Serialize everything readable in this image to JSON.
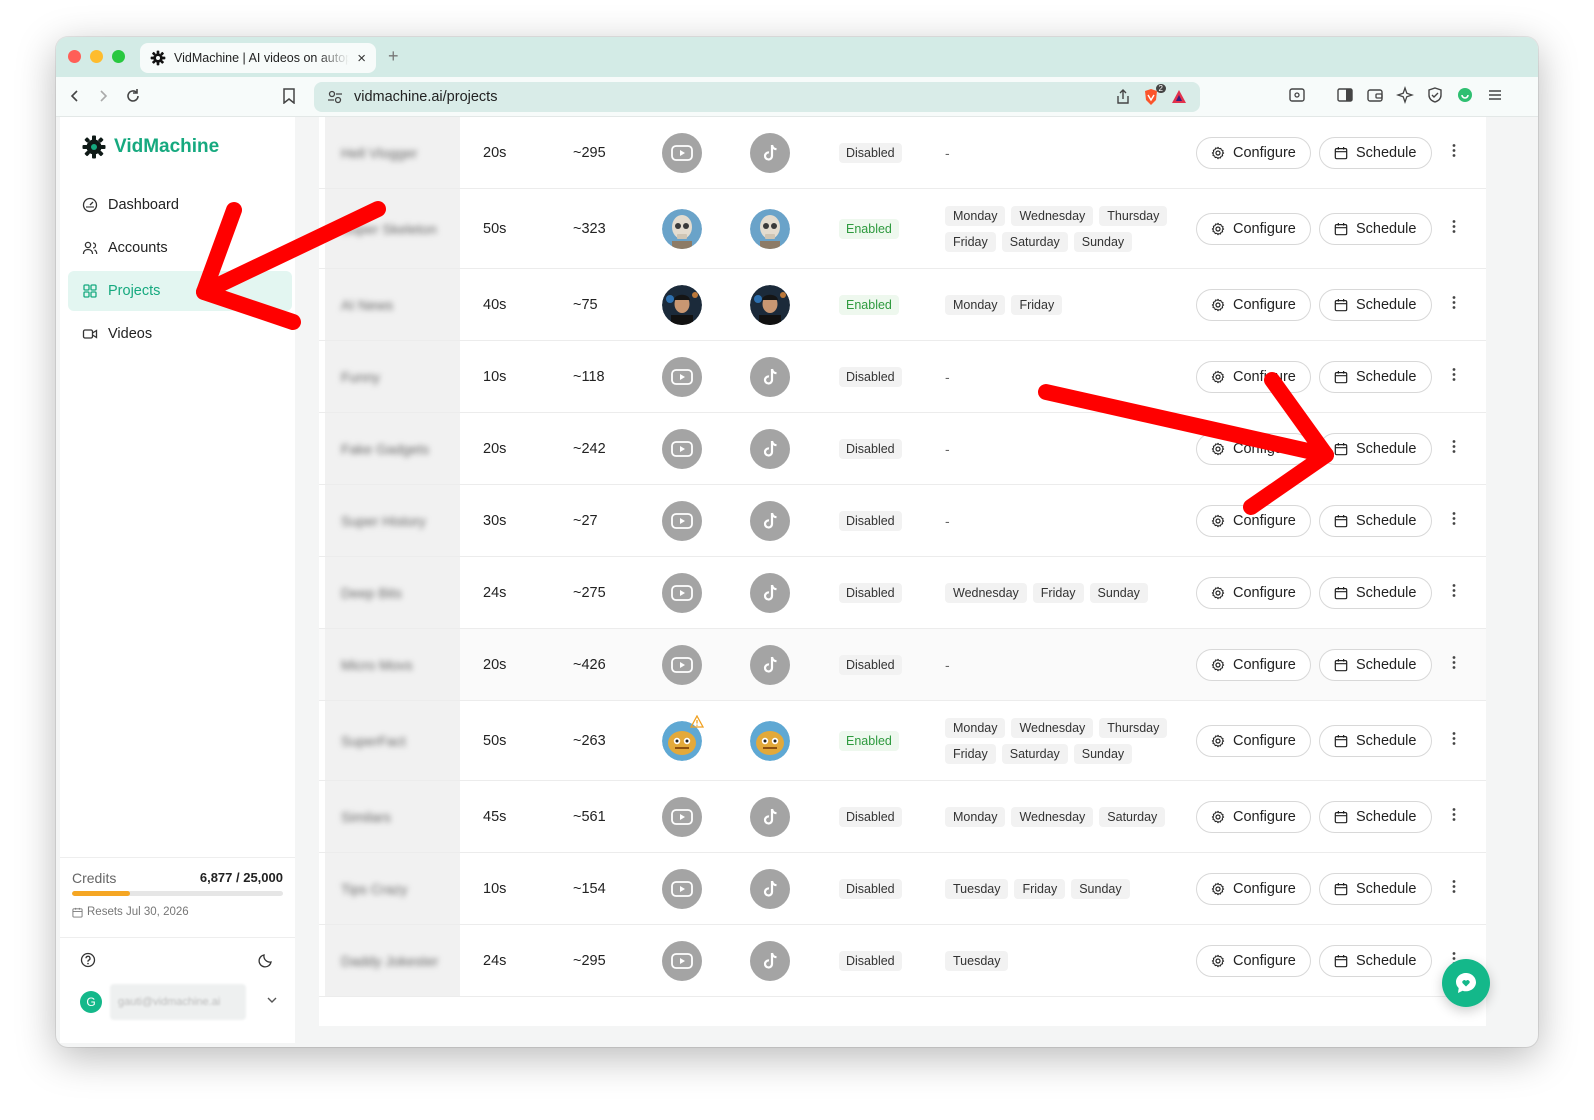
{
  "browser": {
    "tab_title": "VidMachine | AI videos on autopilot",
    "url": "vidmachine.ai/projects",
    "brave_badge": "2",
    "new_tab": "+",
    "close_tab": "×"
  },
  "sidebar": {
    "brand": "VidMachine",
    "items": [
      {
        "label": "Dashboard",
        "icon": "gauge-icon"
      },
      {
        "label": "Accounts",
        "icon": "users-icon"
      },
      {
        "label": "Projects",
        "icon": "grid-icon",
        "active": true
      },
      {
        "label": "Videos",
        "icon": "video-icon"
      }
    ],
    "credits_label": "Credits",
    "credits_value": "6,877 / 25,000",
    "credits_used_fraction": 0.275,
    "resets": "Resets Jul 30, 2026",
    "user_initial": "G",
    "user_email": "gauti@vidmachine.ai"
  },
  "colors": {
    "brand": "#16a97f",
    "enabled_text": "#2e9a3e",
    "credits_bar": "#f5a623",
    "arrow": "#ff0000"
  },
  "table": {
    "configure_label": "Configure",
    "schedule_label": "Schedule",
    "rows": [
      {
        "name": "Hell Vlogger",
        "duration": "20s",
        "count": "~295",
        "yt": "youtube-icon",
        "tt": "tiktok-icon",
        "status": "Disabled",
        "days": [
          "-"
        ]
      },
      {
        "name": "Super Skeleton",
        "duration": "50s",
        "count": "~323",
        "yt": "skeleton-avatar",
        "tt": "skeleton-avatar",
        "status": "Enabled",
        "days": [
          "Monday",
          "Wednesday",
          "Thursday",
          "Friday",
          "Saturday",
          "Sunday"
        ]
      },
      {
        "name": "AI News",
        "duration": "40s",
        "count": "~75",
        "yt": "person-avatar",
        "tt": "person-avatar",
        "status": "Enabled",
        "days": [
          "Monday",
          "Friday"
        ]
      },
      {
        "name": "Funny",
        "duration": "10s",
        "count": "~118",
        "yt": "youtube-icon",
        "tt": "tiktok-icon",
        "status": "Disabled",
        "days": [
          "-"
        ]
      },
      {
        "name": "Fake Gadgets",
        "duration": "20s",
        "count": "~242",
        "yt": "youtube-icon",
        "tt": "tiktok-icon",
        "status": "Disabled",
        "days": [
          "-"
        ]
      },
      {
        "name": "Super History",
        "duration": "30s",
        "count": "~27",
        "yt": "youtube-icon",
        "tt": "tiktok-icon",
        "status": "Disabled",
        "days": [
          "-"
        ]
      },
      {
        "name": "Deep Bits",
        "duration": "24s",
        "count": "~275",
        "yt": "youtube-icon",
        "tt": "tiktok-icon",
        "status": "Disabled",
        "days": [
          "Wednesday",
          "Friday",
          "Sunday"
        ]
      },
      {
        "name": "Micro Movs",
        "duration": "20s",
        "count": "~426",
        "yt": "youtube-icon",
        "tt": "tiktok-icon",
        "status": "Disabled",
        "days": [
          "-"
        ]
      },
      {
        "name": "SuperFact",
        "duration": "50s",
        "count": "~263",
        "yt": "mascot-avatar",
        "tt": "mascot-avatar",
        "status": "Enabled",
        "days": [
          "Monday",
          "Wednesday",
          "Thursday",
          "Friday",
          "Saturday",
          "Sunday"
        ],
        "warning": true
      },
      {
        "name": "Similars",
        "duration": "45s",
        "count": "~561",
        "yt": "youtube-icon",
        "tt": "tiktok-icon",
        "status": "Disabled",
        "days": [
          "Monday",
          "Wednesday",
          "Saturday"
        ]
      },
      {
        "name": "Tips Crazy",
        "duration": "10s",
        "count": "~154",
        "yt": "youtube-icon",
        "tt": "tiktok-icon",
        "status": "Disabled",
        "days": [
          "Tuesday",
          "Friday",
          "Sunday"
        ]
      },
      {
        "name": "Daddy Jokester",
        "duration": "24s",
        "count": "~295",
        "yt": "youtube-icon",
        "tt": "tiktok-icon",
        "status": "Disabled",
        "days": [
          "Tuesday"
        ]
      }
    ]
  }
}
